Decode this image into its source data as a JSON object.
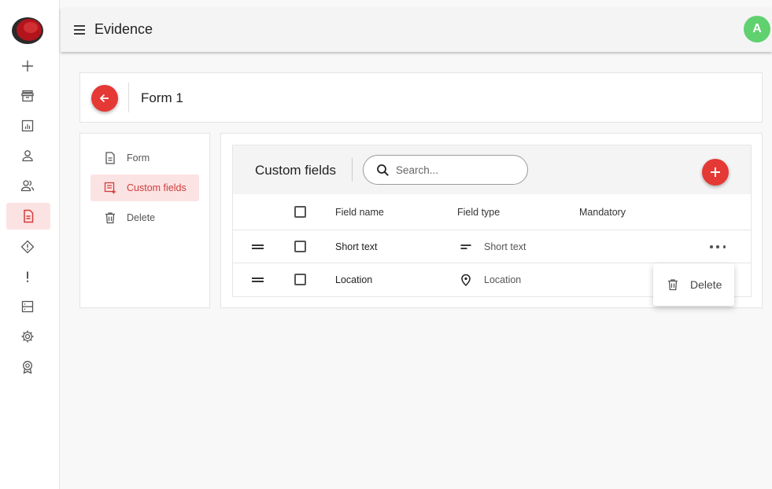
{
  "header": {
    "title": "Evidence",
    "avatar_initial": "A"
  },
  "rail": {
    "items": [
      {
        "icon": "plus-icon",
        "active": false
      },
      {
        "icon": "archive-icon",
        "active": false
      },
      {
        "icon": "report-icon",
        "active": false
      },
      {
        "icon": "user-icon",
        "active": false
      },
      {
        "icon": "users-icon",
        "active": false
      },
      {
        "icon": "document-icon",
        "active": true
      },
      {
        "icon": "warning-diamond-icon",
        "active": false
      },
      {
        "icon": "exclamation-icon",
        "active": false
      },
      {
        "icon": "server-icon",
        "active": false
      },
      {
        "icon": "gear-icon",
        "active": false
      },
      {
        "icon": "award-icon",
        "active": false
      }
    ]
  },
  "form": {
    "title": "Form 1"
  },
  "side_nav": {
    "items": [
      {
        "label": "Form",
        "icon": "document-icon",
        "active": false
      },
      {
        "label": "Custom fields",
        "icon": "custom-fields-icon",
        "active": true
      },
      {
        "label": "Delete",
        "icon": "trash-icon",
        "active": false
      }
    ]
  },
  "custom_fields": {
    "title": "Custom fields",
    "search_placeholder": "Search...",
    "columns": {
      "name": "Field name",
      "type": "Field type",
      "mandatory": "Mandatory"
    },
    "rows": [
      {
        "name": "Short text",
        "type": "Short text",
        "type_icon": "short-text-icon"
      },
      {
        "name": "Location",
        "type": "Location",
        "type_icon": "location-pin-icon"
      }
    ]
  },
  "popup_menu": {
    "delete_label": "Delete"
  },
  "colors": {
    "accent": "#e53935",
    "active_bg": "#fce3e3",
    "avatar": "#5fd16f"
  }
}
